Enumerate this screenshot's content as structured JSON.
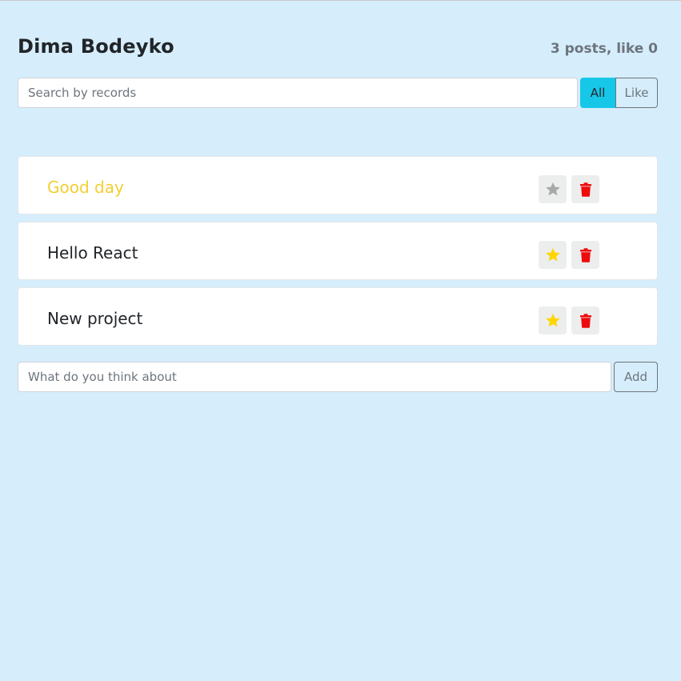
{
  "header": {
    "title": "Dima Bodeyko",
    "stats": "3 posts, like 0"
  },
  "search": {
    "placeholder": "Search by records",
    "filters": [
      {
        "label": "All",
        "active": true
      },
      {
        "label": "Like",
        "active": false
      }
    ]
  },
  "posts": [
    {
      "label": "Good day",
      "important": true,
      "liked": false,
      "star_icon": "star-icon",
      "delete_icon": "trash-icon"
    },
    {
      "label": "Hello React",
      "important": false,
      "liked": true,
      "star_icon": "star-icon",
      "delete_icon": "trash-icon"
    },
    {
      "label": "New project",
      "important": false,
      "liked": true,
      "star_icon": "star-icon",
      "delete_icon": "trash-icon"
    }
  ],
  "add_form": {
    "placeholder": "What do you think about",
    "button_label": "Add"
  },
  "colors": {
    "background": "#d6edfb",
    "important_text": "#f2cf33",
    "star_active": "#ffd500",
    "star_inactive": "#a8a8a8",
    "trash": "#ee0b0b",
    "filter_active": "#17c7e8"
  }
}
